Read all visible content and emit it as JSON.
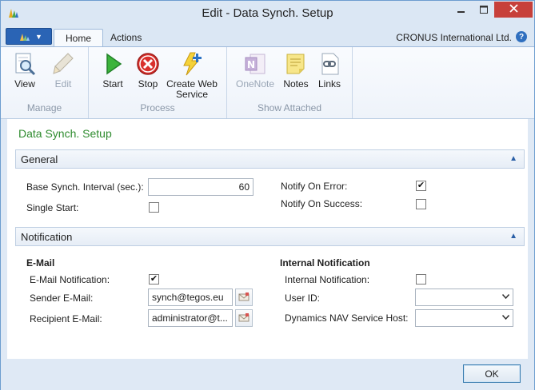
{
  "window": {
    "title": "Edit - Data Synch. Setup"
  },
  "ribbon": {
    "tabs": [
      {
        "label": "Home"
      },
      {
        "label": "Actions"
      }
    ],
    "company": "CRONUS International Ltd.",
    "groups": {
      "manage": {
        "label": "Manage",
        "buttons": [
          {
            "label": "View",
            "icon": "view-icon",
            "enabled": true
          },
          {
            "label": "Edit",
            "icon": "edit-pencil-icon",
            "enabled": false
          }
        ]
      },
      "process": {
        "label": "Process",
        "buttons": [
          {
            "label": "Start",
            "icon": "start-play-icon",
            "enabled": true
          },
          {
            "label": "Stop",
            "icon": "stop-icon",
            "enabled": true
          },
          {
            "label": "Create Web Service",
            "line1": "Create Web",
            "line2": "Service",
            "icon": "create-web-service-icon",
            "enabled": true
          }
        ]
      },
      "show_attached": {
        "label": "Show Attached",
        "buttons": [
          {
            "label": "OneNote",
            "icon": "onenote-icon",
            "enabled": false
          },
          {
            "label": "Notes",
            "icon": "notes-icon",
            "enabled": true
          },
          {
            "label": "Links",
            "icon": "links-icon",
            "enabled": true
          }
        ]
      }
    }
  },
  "page": {
    "title": "Data Synch. Setup",
    "general": {
      "header": "General",
      "base_interval_label": "Base Synch. Interval (sec.):",
      "base_interval_value": "60",
      "single_start_label": "Single Start:",
      "single_start_checked": false,
      "notify_on_error_label": "Notify On Error:",
      "notify_on_error_checked": true,
      "notify_on_success_label": "Notify On Success:",
      "notify_on_success_checked": false
    },
    "notification": {
      "header": "Notification",
      "email": {
        "heading": "E-Mail",
        "email_notification_label": "E-Mail Notification:",
        "email_notification_checked": true,
        "sender_label": "Sender E-Mail:",
        "sender_value": "synch@tegos.eu",
        "recipient_label": "Recipient E-Mail:",
        "recipient_value": "administrator@t..."
      },
      "internal": {
        "heading": "Internal Notification",
        "internal_notification_label": "Internal Notification:",
        "internal_notification_checked": false,
        "user_id_label": "User ID:",
        "user_id_value": "",
        "host_label": "Dynamics NAV Service Host:",
        "host_value": ""
      }
    }
  },
  "footer": {
    "ok_label": "OK"
  },
  "colors": {
    "accent": "#2a64b5",
    "page_title": "#2e8b2e",
    "close_button": "#c7403a"
  }
}
